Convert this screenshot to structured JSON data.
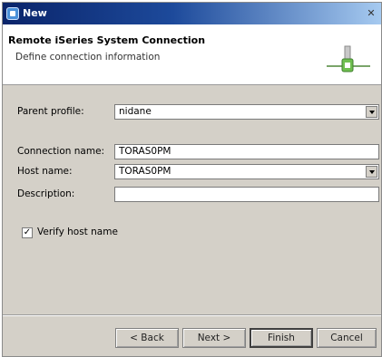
{
  "window": {
    "title": "New"
  },
  "banner": {
    "title": "Remote iSeries System Connection",
    "description": "Define connection information"
  },
  "form": {
    "parent_profile": {
      "label": "Parent profile:",
      "value": "nidane"
    },
    "connection_name": {
      "label": "Connection name:",
      "value": "TORAS0PM"
    },
    "host_name": {
      "label": "Host name:",
      "value": "TORAS0PM"
    },
    "description": {
      "label": "Description:",
      "value": ""
    },
    "verify_host": {
      "label": "Verify host name",
      "checked": true,
      "check_glyph": "✓"
    }
  },
  "buttons": {
    "back": "< Back",
    "next": "Next >",
    "finish": "Finish",
    "cancel": "Cancel"
  },
  "icons": [
    "app-icon",
    "close-icon",
    "connection-wizard-icon",
    "chevron-down-icon"
  ],
  "colors": {
    "titlebar": "#0a246a",
    "dialog": "#d4d0c8"
  }
}
